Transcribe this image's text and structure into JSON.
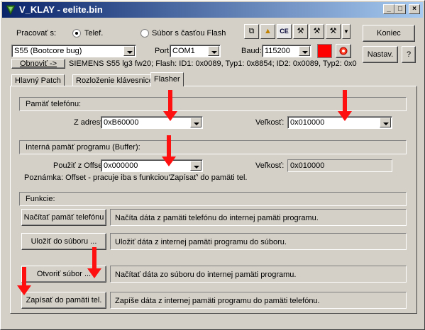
{
  "window": {
    "title": "V_KLAY - eelite.bin"
  },
  "top": {
    "mode_label": "Pracovať s:",
    "radio_phone": "Telef.",
    "radio_file": "Súbor s časťou Flash",
    "model_value": "S55 (Bootcore bug)",
    "port_label": "Port",
    "port_value": "COM1",
    "baud_label": "Baud:",
    "baud_value": "115200",
    "refresh_label": "Obnoviť ->",
    "phone_info": "SIEMENS S55 lg3 fw20; Flash: ID1: 0x0089, Typ1: 0x8854; ID2: 0x0089, Typ2: 0x0",
    "exit_label": "Koniec",
    "settings_label": "Nastav.",
    "help_label": "?",
    "status_color": "#ff0000"
  },
  "tabs": [
    "Hlavný Patch",
    "Rozloženie klávesnice",
    "Flasher"
  ],
  "flasher": {
    "phone_memory_title": "Pamäť telefónu:",
    "from_address_label": "Z adresy:",
    "from_address_value": "0xB60000",
    "size_label": "Veľkosť:",
    "size_value": "0x010000",
    "buffer_title": "Interná pamäť programu (Buffer):",
    "offset_label": "Použiť z Offsetu:",
    "offset_value": "0x000000",
    "buffer_size_label": "Veľkosť:",
    "buffer_size_value": "0x010000",
    "note": "Poznámka: Offset - pracuje iba s funkciou'Zapísať' do pamäti tel.",
    "functions_title": "Funkcie:",
    "functions": [
      {
        "button": "Načítať pamäť telefónu",
        "description": "Načíta dáta z pamäti telefónu do internej pamäti programu."
      },
      {
        "button": "Uložiť do súboru ...",
        "description": "Uložiť dáta z internej pamäti programu do súboru."
      },
      {
        "button": "Otvoriť súbor ...",
        "description": "Načítať dáta zo súboru do internej pamäti programu."
      },
      {
        "button": "Zapísať do pamäti tel.",
        "description": "Zapíše dáta z internej pamäti programu do pamäti telefónu."
      }
    ]
  },
  "icons": [
    "app-icon",
    "copy-icon",
    "bell-icon",
    "ce-icon",
    "tools-icon",
    "tools-2-icon",
    "tools-3-icon",
    "dropdown-icon",
    "gear-icon",
    "annotation-arrow"
  ]
}
